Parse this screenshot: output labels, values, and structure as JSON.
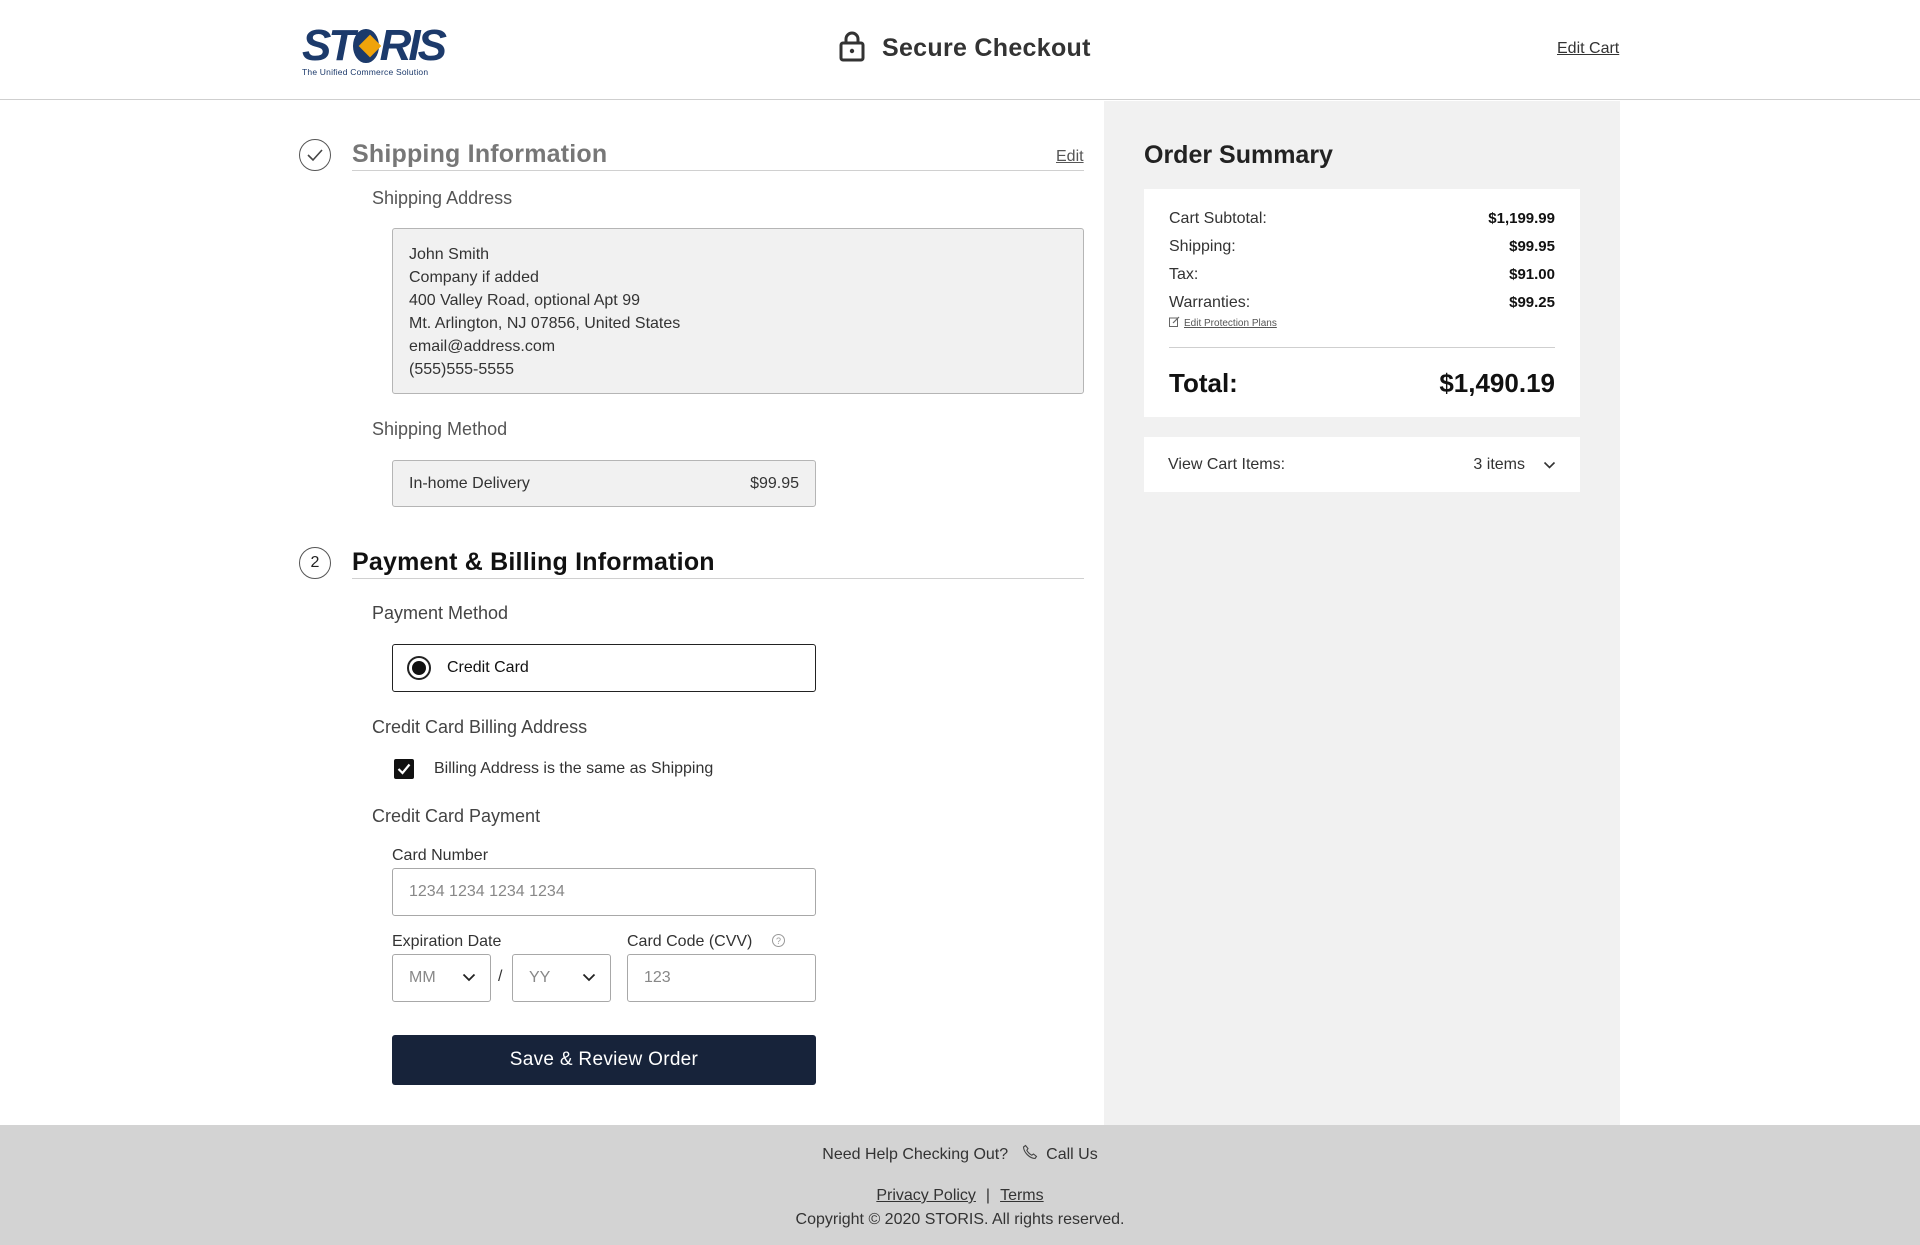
{
  "header": {
    "logo_text_left": "ST",
    "logo_text_right": "RIS",
    "logo_tagline": "The Unified Commerce Solution",
    "title": "Secure Checkout",
    "edit_cart": "Edit Cart",
    "icons": {
      "lock": "lock-icon"
    }
  },
  "shipping": {
    "step": "✓",
    "title": "Shipping Information",
    "edit": "Edit",
    "address_label": "Shipping Address",
    "address_lines": [
      "John Smith",
      "Company if added",
      "400 Valley Road, optional Apt 99",
      "Mt. Arlington, NJ 07856, United States",
      "email@address.com",
      "(555)555-5555"
    ],
    "method_label": "Shipping Method",
    "method_name": "In-home Delivery",
    "method_price": "$99.95"
  },
  "payment": {
    "step": "2",
    "title": "Payment & Billing Information",
    "method_label": "Payment Method",
    "method_option": "Credit Card",
    "billing_label": "Credit Card Billing Address",
    "billing_same": "Billing Address is the same as Shipping",
    "card_payment_label": "Credit Card Payment",
    "card_number_label": "Card Number",
    "card_number_placeholder": "1234 1234 1234 1234",
    "expiration_label": "Expiration Date",
    "month_placeholder": "MM",
    "year_placeholder": "YY",
    "slash": "/",
    "cvv_label": "Card Code (CVV)",
    "cvv_help": "?",
    "cvv_placeholder": "123",
    "submit": "Save & Review Order"
  },
  "summary": {
    "title": "Order Summary",
    "rows": [
      {
        "label": "Cart Subtotal:",
        "value": "$1,199.99"
      },
      {
        "label": "Shipping:",
        "value": "$99.95"
      },
      {
        "label": "Tax:",
        "value": "$91.00"
      },
      {
        "label": "Warranties:",
        "value": "$99.25"
      }
    ],
    "edit_protection": "Edit Protection Plans",
    "total_label": "Total:",
    "total_value": "$1,490.19",
    "view_cart_label": "View Cart Items:",
    "view_cart_count": "3 items"
  },
  "footer": {
    "help_text": "Need Help Checking Out?",
    "call_us": "Call Us",
    "privacy": "Privacy Policy",
    "separator": "|",
    "terms": "Terms",
    "copyright": "Copyright © 2020 STORIS. All rights reserved."
  },
  "colors": {
    "brand_navy": "#1c3a6b",
    "brand_gold": "#f0a30a",
    "button_bg": "#17233a",
    "summary_bg": "#f1f1f1",
    "footer_bg": "#d3d3d3"
  }
}
